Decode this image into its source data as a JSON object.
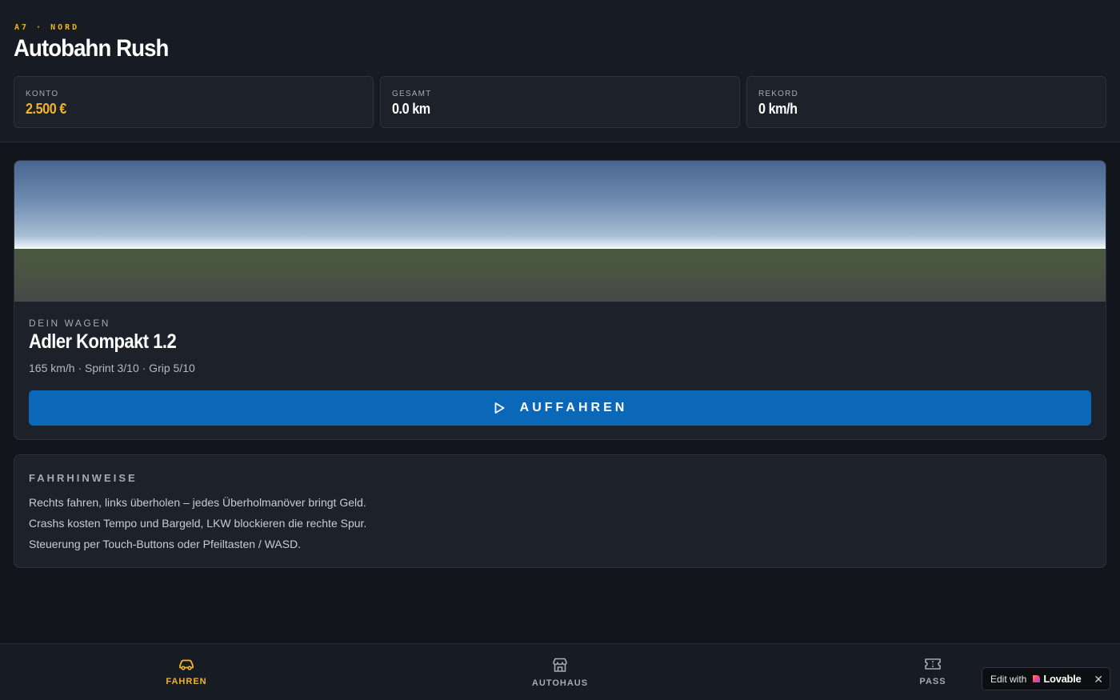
{
  "header": {
    "eyebrow": "A7 · NORD",
    "title": "Autobahn Rush",
    "stats": [
      {
        "label": "KONTO",
        "value": "2.500 €"
      },
      {
        "label": "GESAMT",
        "value": "0.0 km"
      },
      {
        "label": "REKORD",
        "value": "0 km/h"
      }
    ]
  },
  "car": {
    "eyebrow": "DEIN WAGEN",
    "name": "Adler Kompakt 1.2",
    "specs": "165 km/h · Sprint 3/10 · Grip 5/10",
    "drive_button": "AUFFAHREN"
  },
  "hints": {
    "title": "FAHRHINWEISE",
    "lines": [
      "Rechts fahren, links überholen – jedes Überholmanöver bringt Geld.",
      "Crashs kosten Tempo und Bargeld, LKW blockieren die rechte Spur.",
      "Steuerung per Touch-Buttons oder Pfeiltasten / WASD."
    ]
  },
  "nav": {
    "items": [
      {
        "label": "FAHREN",
        "icon": "car-icon",
        "active": true
      },
      {
        "label": "AUTOHAUS",
        "icon": "store-icon",
        "active": false
      },
      {
        "label": "PASS",
        "icon": "ticket-icon",
        "active": false
      }
    ]
  },
  "badge": {
    "edit_text": "Edit with",
    "brand": "Lovable",
    "close": "✕"
  },
  "colors": {
    "accent": "#f2b327",
    "primary": "#0b67b8",
    "background": "#11151b",
    "card": "#1c212a"
  }
}
